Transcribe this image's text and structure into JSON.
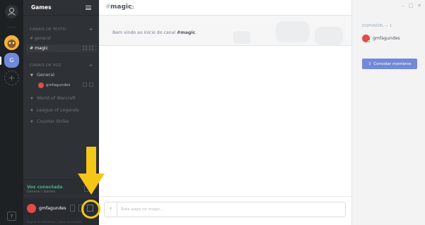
{
  "server": {
    "name": "Games",
    "server_initial": "G"
  },
  "sidebar": {
    "text_category": "Canais de texto",
    "text_channels": [
      {
        "label": "# general"
      },
      {
        "label": "# magic"
      }
    ],
    "voice_category": "Canais de voz",
    "voice_channels": [
      {
        "label": "General"
      },
      {
        "label": "World of Warcraft"
      },
      {
        "label": "League of Legends"
      },
      {
        "label": "Counter Strike"
      }
    ],
    "voice_user": "gmfagundes",
    "voice_status": "Voz conectada",
    "voice_sub": "General / Games",
    "user_name": "gmfagundes",
    "footer": "Pagina de aberturas / jabuu recrutadas"
  },
  "main": {
    "hash": "#",
    "channel_name": "magic",
    "welcome_prefix": "Bem vindo ao início do canal ",
    "welcome_channel": "#magic",
    "welcome_suffix": ".",
    "composer_placeholder": "Bate papo no magic..."
  },
  "members": {
    "online_header": "Disponível — 1",
    "list": [
      {
        "name": "gmfagundes"
      }
    ],
    "invite_label": "Convidar membros"
  },
  "window": {
    "minimize": "–",
    "maximize": "□",
    "close": "✕"
  },
  "colors": {
    "accent": "#7289da",
    "online": "#43b581",
    "annotation": "#f5c518"
  }
}
